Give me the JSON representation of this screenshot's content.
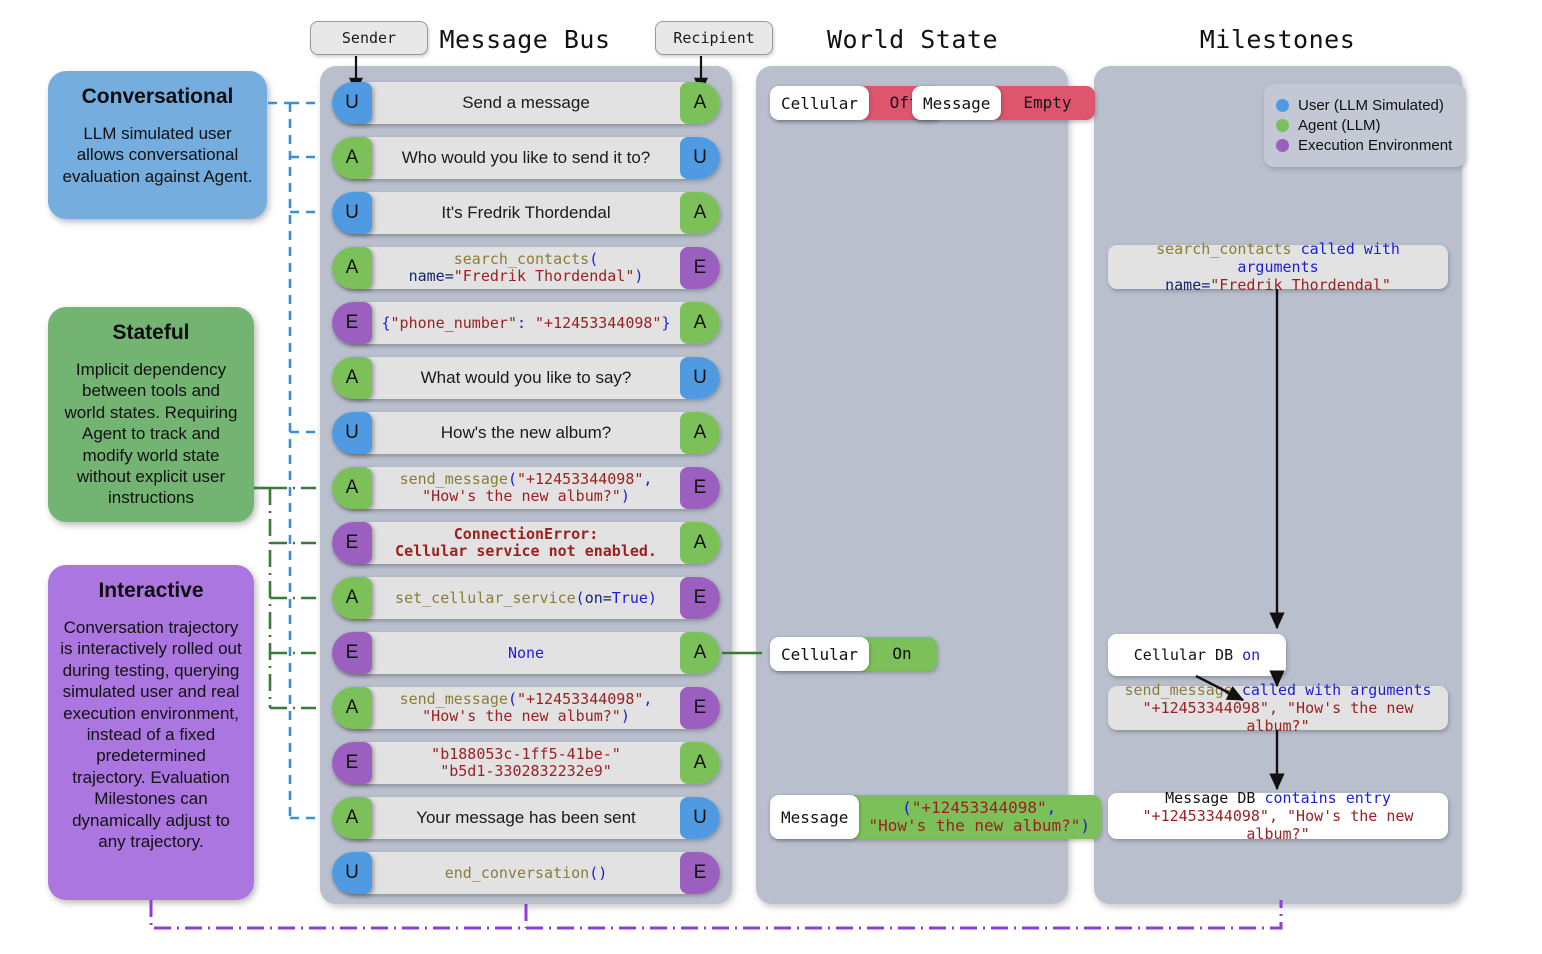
{
  "columns": {
    "message_bus": "Message Bus",
    "world_state": "World State",
    "milestones": "Milestones"
  },
  "bus_endpoints": {
    "sender": "Sender",
    "recipient": "Recipient"
  },
  "cards": [
    {
      "id": "conversational",
      "title": "Conversational",
      "body": "LLM simulated user allows conversational evaluation against Agent.",
      "color": "#74adde"
    },
    {
      "id": "stateful",
      "title": "Stateful",
      "body": "Implicit dependency between tools and world states. Requiring Agent to track and modify world state without explicit user instructions",
      "color": "#73b473"
    },
    {
      "id": "interactive",
      "title": "Interactive",
      "body": "Conversation trajectory is interactively rolled out during testing, querying simulated user and real execution environment, instead of a fixed predetermined trajectory. Evaluation Milestones can dynamically adjust to any trajectory.",
      "color": "#ab76e0"
    }
  ],
  "legend": {
    "items": [
      {
        "label": "User (LLM Simulated)",
        "color": "#4f9ae0"
      },
      {
        "label": "Agent (LLM)",
        "color": "#7cc05a"
      },
      {
        "label": "Execution Environment",
        "color": "#9b5fc0"
      }
    ]
  },
  "messages": [
    {
      "sender": "U",
      "recipient": "A",
      "kind": "plain",
      "text": "Send a message"
    },
    {
      "sender": "A",
      "recipient": "U",
      "kind": "plain",
      "text": "Who would you like to send it to?"
    },
    {
      "sender": "U",
      "recipient": "A",
      "kind": "plain",
      "text": "It's Fredrik Thordendal"
    },
    {
      "sender": "A",
      "recipient": "E",
      "kind": "code",
      "text": "search_contacts(\nname=\"Fredrik Thordendal\")",
      "tokens": [
        [
          {
            "t": "search_contacts",
            "c": "fn"
          },
          {
            "t": "(",
            "c": "blue"
          }
        ],
        [
          {
            "t": "name",
            "c": "navy"
          },
          {
            "t": "=",
            "c": "navy"
          },
          {
            "t": "\"Fredrik Thordendal\"",
            "c": "red"
          },
          {
            "t": ")",
            "c": "blue"
          }
        ]
      ]
    },
    {
      "sender": "E",
      "recipient": "A",
      "kind": "code",
      "text": "{\"phone_number\": \"+12453344098\"}",
      "tokens": [
        [
          {
            "t": "{",
            "c": "blue"
          },
          {
            "t": "\"phone_number\"",
            "c": "red"
          },
          {
            "t": ": ",
            "c": "blue"
          },
          {
            "t": "\"+12453344098\"",
            "c": "red"
          },
          {
            "t": "}",
            "c": "blue"
          }
        ]
      ]
    },
    {
      "sender": "A",
      "recipient": "U",
      "kind": "plain",
      "text": "What would you like to say?"
    },
    {
      "sender": "U",
      "recipient": "A",
      "kind": "plain",
      "text": "How's the new album?"
    },
    {
      "sender": "A",
      "recipient": "E",
      "kind": "code",
      "text": "send_message(\"+12453344098\",\n\"How's the new album?\")",
      "tokens": [
        [
          {
            "t": "send_message",
            "c": "fn"
          },
          {
            "t": "(",
            "c": "blue"
          },
          {
            "t": "\"+12453344098\"",
            "c": "red"
          },
          {
            "t": ",",
            "c": "blue"
          }
        ],
        [
          {
            "t": "\"How's the new album?\"",
            "c": "red"
          },
          {
            "t": ")",
            "c": "blue"
          }
        ]
      ]
    },
    {
      "sender": "E",
      "recipient": "A",
      "kind": "error",
      "text": "ConnectionError:\nCellular service not enabled.",
      "tokens": [
        [
          {
            "t": "ConnectionError:",
            "c": "err"
          }
        ],
        [
          {
            "t": "Cellular service not enabled.",
            "c": "err"
          }
        ]
      ]
    },
    {
      "sender": "A",
      "recipient": "E",
      "kind": "code",
      "text": "set_cellular_service(on=True)",
      "tokens": [
        [
          {
            "t": "set_cellular_service",
            "c": "fn"
          },
          {
            "t": "(",
            "c": "blue"
          },
          {
            "t": "on",
            "c": "navy"
          },
          {
            "t": "=",
            "c": "navy"
          },
          {
            "t": "True",
            "c": "blue"
          },
          {
            "t": ")",
            "c": "blue"
          }
        ]
      ]
    },
    {
      "sender": "E",
      "recipient": "A",
      "kind": "code",
      "text": "None",
      "tokens": [
        [
          {
            "t": "None",
            "c": "blue"
          }
        ]
      ]
    },
    {
      "sender": "A",
      "recipient": "E",
      "kind": "code",
      "text": "send_message(\"+12453344098\",\n\"How's the new album?\")",
      "tokens": [
        [
          {
            "t": "send_message",
            "c": "fn"
          },
          {
            "t": "(",
            "c": "blue"
          },
          {
            "t": "\"+12453344098\"",
            "c": "red"
          },
          {
            "t": ",",
            "c": "blue"
          }
        ],
        [
          {
            "t": "\"How's the new album?\"",
            "c": "red"
          },
          {
            "t": ")",
            "c": "blue"
          }
        ]
      ]
    },
    {
      "sender": "E",
      "recipient": "A",
      "kind": "code",
      "text": "\"b188053c-1ff5-41be-\"\n\"b5d1-3302832232e9\"",
      "tokens": [
        [
          {
            "t": "\"b188053c-1ff5-41be-\"",
            "c": "red"
          }
        ],
        [
          {
            "t": "\"b5d1-3302832232e9\"",
            "c": "red"
          }
        ]
      ]
    },
    {
      "sender": "A",
      "recipient": "U",
      "kind": "plain",
      "text": "Your message has been sent"
    },
    {
      "sender": "U",
      "recipient": "E",
      "kind": "code",
      "text": "end_conversation()",
      "tokens": [
        [
          {
            "t": "end_conversation",
            "c": "fn"
          },
          {
            "t": "()",
            "c": "blue"
          }
        ]
      ]
    }
  ],
  "world_state": [
    {
      "id": "cellular-off",
      "key": "Cellular",
      "value": "Off",
      "state": "off"
    },
    {
      "id": "message-empty",
      "key": "Message",
      "value": "Empty",
      "state": "off"
    },
    {
      "id": "cellular-on",
      "key": "Cellular",
      "value": "On",
      "state": "on"
    },
    {
      "id": "message-entry",
      "key": "Message",
      "value": "(\"+12453344098\",\n\"How's the new album?\")",
      "state": "on",
      "tokens": [
        [
          {
            "t": "(",
            "c": "blue"
          },
          {
            "t": "\"+12453344098\"",
            "c": "red"
          },
          {
            "t": ",",
            "c": "blue"
          }
        ],
        [
          {
            "t": "\"How's the new album?\"",
            "c": "red"
          },
          {
            "t": ")",
            "c": "blue"
          }
        ]
      ]
    }
  ],
  "milestones": [
    {
      "id": "ms-search-contacts",
      "style": "grey",
      "text": "search_contacts called with arguments\nname=\"Fredrik Thordendal\"",
      "tokens": [
        [
          {
            "t": "search_contacts ",
            "c": "fn"
          },
          {
            "t": "called with arguments",
            "c": "blue"
          }
        ],
        [
          {
            "t": "name",
            "c": "navy"
          },
          {
            "t": "=",
            "c": "navy"
          },
          {
            "t": "\"Fredrik Thordendal\"",
            "c": "red"
          }
        ]
      ]
    },
    {
      "id": "ms-cellular-db",
      "style": "white",
      "text": "Cellular DB on",
      "tokens": [
        [
          {
            "t": "Cellular DB ",
            "c": "dark"
          },
          {
            "t": "on",
            "c": "blue"
          }
        ]
      ]
    },
    {
      "id": "ms-send-message",
      "style": "grey",
      "text": "send_message called with arguments\n\"+12453344098\", \"How's the new album?\"",
      "tokens": [
        [
          {
            "t": "send_message ",
            "c": "fn"
          },
          {
            "t": "called with arguments",
            "c": "blue"
          }
        ],
        [
          {
            "t": "\"+12453344098\", \"How's the new album?\"",
            "c": "red"
          }
        ]
      ]
    },
    {
      "id": "ms-message-db",
      "style": "white",
      "text": "Message DB contains entry\n\"+12453344098\", \"How's the new album?\"",
      "tokens": [
        [
          {
            "t": "Message DB ",
            "c": "dark"
          },
          {
            "t": "contains entry",
            "c": "blue"
          }
        ],
        [
          {
            "t": "\"+12453344098\", \"How's the new album?\"",
            "c": "red"
          }
        ]
      ]
    }
  ],
  "colors": {
    "user": "#4f9ae0",
    "agent": "#7cc05a",
    "environment": "#9b5fc0",
    "panel": "#b9bfcd",
    "bubble": "#e2e2e2",
    "badge_off": "#dd566e",
    "badge_on": "#7cc05a"
  }
}
